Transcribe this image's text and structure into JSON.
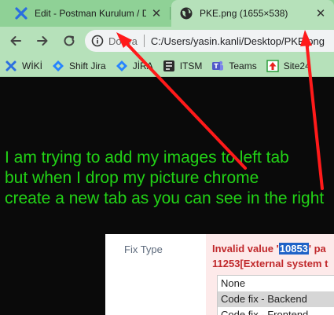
{
  "colors": {
    "tab_strip": "#8fd196",
    "active_tab": "#b6e1ba",
    "annotation_text": "#22d316",
    "arrow": "#ff1a1a",
    "error_text": "#c0282b"
  },
  "tabs": [
    {
      "title": "Edit - Postman Kurulum / D",
      "icon": "postman-x-icon",
      "active": false,
      "close": "✕"
    },
    {
      "title": "PKE.png (1655×538)",
      "icon": "globe-icon",
      "active": true,
      "close": "✕"
    }
  ],
  "address_bar": {
    "scheme": "Dosya",
    "url": "C:/Users/yasin.kanli/Desktop/PKE.png"
  },
  "bookmarks": [
    {
      "label": "WİKİ",
      "icon": "blue-x-icon"
    },
    {
      "label": "Shift Jira",
      "icon": "jira-diamond-icon"
    },
    {
      "label": "JİRA",
      "icon": "jira-diamond-icon"
    },
    {
      "label": "ITSM",
      "icon": "itsm-icon"
    },
    {
      "label": "Teams",
      "icon": "teams-icon"
    },
    {
      "label": "Site24",
      "icon": "site24-icon"
    }
  ],
  "annotation": {
    "lines": [
      "I am trying to add my images to left tab",
      "but when I drop my picture chrome",
      "create a new tab as you can see in the right"
    ]
  },
  "embedded_image": {
    "field_label": "Fix Type",
    "error_prefix": "Invalid value '",
    "error_value": "10853",
    "error_suffix": "' pa",
    "error_line2": "11253[External system t",
    "options": [
      "None",
      "Code fix - Backend",
      "Code fix - Frontend"
    ],
    "selected_index": 1
  }
}
